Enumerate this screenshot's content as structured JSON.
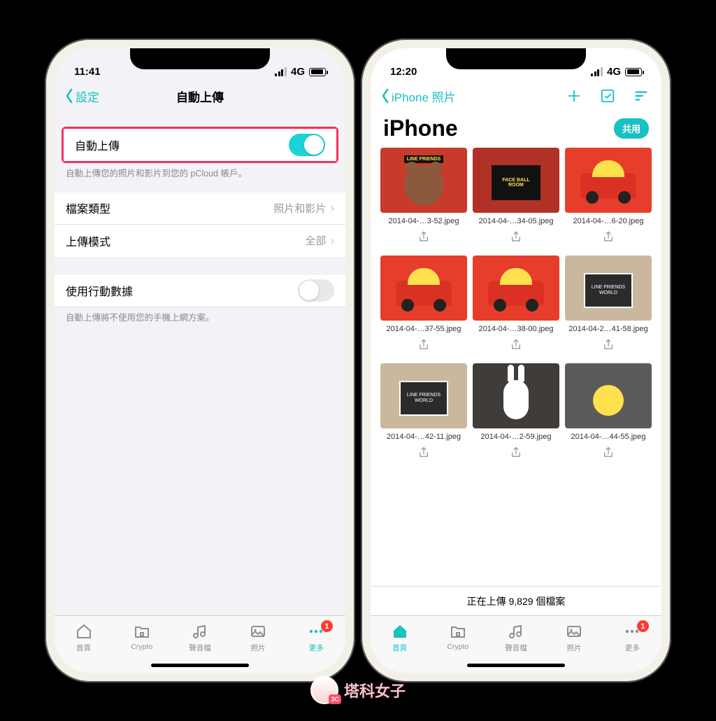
{
  "colors": {
    "accent": "#19c1c3",
    "highlight": "#ff2d55"
  },
  "watermark": "塔科女子",
  "left": {
    "status": {
      "time": "11:41",
      "carrier": "4G"
    },
    "nav": {
      "back": "設定",
      "title": "自動上傳"
    },
    "auto_upload": {
      "label": "自動上傳",
      "on": true
    },
    "auto_upload_desc": "自動上傳您的照片和影片到您的 pCloud 帳戶。",
    "file_type": {
      "label": "檔案類型",
      "value": "照片和影片"
    },
    "upload_mode": {
      "label": "上傳模式",
      "value": "全部"
    },
    "cellular": {
      "label": "使用行動數據",
      "on": false
    },
    "cellular_desc": "自動上傳將不使用您的手機上網方案。"
  },
  "right": {
    "status": {
      "time": "12:20",
      "carrier": "4G"
    },
    "nav": {
      "back": "iPhone 照片"
    },
    "title": "iPhone",
    "share_pill": "共用",
    "upload_status": "正在上傳 9,829 個檔案",
    "thumbs": [
      {
        "name": "2014-04-…3-52.jpeg",
        "style": "brown-sign",
        "sign": "LINE FRIENDS"
      },
      {
        "name": "2014-04-…34-05.jpeg",
        "style": "face-sign",
        "sign": "FACE BALL\nROOM"
      },
      {
        "name": "2014-04-…6-20.jpeg",
        "style": "car"
      },
      {
        "name": "2014-04-…37-55.jpeg",
        "style": "car"
      },
      {
        "name": "2014-04-…38-00.jpeg",
        "style": "car"
      },
      {
        "name": "2014-04-2…41-58.jpeg",
        "style": "world",
        "sign": "LINE FRIENDS\nWORLD"
      },
      {
        "name": "2014-04-…42-11.jpeg",
        "style": "world",
        "sign": "LINE FRIENDS\nWORLD"
      },
      {
        "name": "2014-04-…2-59.jpeg",
        "style": "cony"
      },
      {
        "name": "2014-04-…44-55.jpeg",
        "style": "sally"
      }
    ]
  },
  "tabs": [
    {
      "id": "home",
      "label": "首頁"
    },
    {
      "id": "crypto",
      "label": "Crypto"
    },
    {
      "id": "audio",
      "label": "聲音檔"
    },
    {
      "id": "photo",
      "label": "照片"
    },
    {
      "id": "more",
      "label": "更多",
      "badge": "1"
    }
  ]
}
